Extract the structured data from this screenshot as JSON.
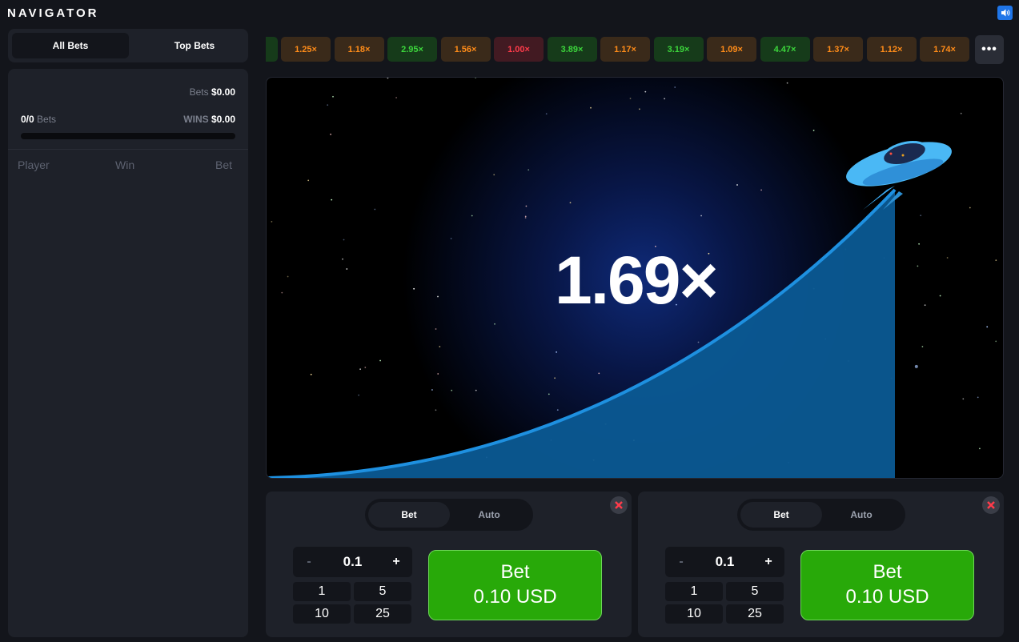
{
  "app": {
    "logo": "NAVIGATOR",
    "sound_icon": "speaker-icon"
  },
  "sidebar": {
    "tabs": [
      {
        "label": "All Bets",
        "active": true
      },
      {
        "label": "Top Bets",
        "active": false
      }
    ],
    "bets_label": "Bets",
    "bets_total": "$0.00",
    "bets_count": "0/0",
    "bets_count_label": "Bets",
    "wins_label": "WINS",
    "wins_total": "$0.00",
    "columns": [
      "Player",
      "Win",
      "Bet"
    ]
  },
  "history": [
    {
      "value": "",
      "color": "green"
    },
    {
      "value": "1.25×",
      "color": "orange"
    },
    {
      "value": "1.18×",
      "color": "orange"
    },
    {
      "value": "2.95×",
      "color": "green"
    },
    {
      "value": "1.56×",
      "color": "orange"
    },
    {
      "value": "1.00×",
      "color": "red"
    },
    {
      "value": "3.89×",
      "color": "green"
    },
    {
      "value": "1.17×",
      "color": "orange"
    },
    {
      "value": "3.19×",
      "color": "green"
    },
    {
      "value": "1.09×",
      "color": "orange"
    },
    {
      "value": "4.47×",
      "color": "green"
    },
    {
      "value": "1.37×",
      "color": "orange"
    },
    {
      "value": "1.12×",
      "color": "orange"
    },
    {
      "value": "1.74×",
      "color": "orange"
    }
  ],
  "history_more": "•••",
  "game": {
    "multiplier": "1.69×",
    "ship_icon": "ufo-icon"
  },
  "bet_panels": [
    {
      "modes": [
        "Bet",
        "Auto"
      ],
      "active_mode": "Bet",
      "minus": "-",
      "plus": "+",
      "amount": "0.1",
      "quick": [
        "1",
        "5",
        "10",
        "25"
      ],
      "button_line1": "Bet",
      "button_line2": "0.10 USD"
    },
    {
      "modes": [
        "Bet",
        "Auto"
      ],
      "active_mode": "Bet",
      "minus": "-",
      "plus": "+",
      "amount": "0.1",
      "quick": [
        "1",
        "5",
        "10",
        "25"
      ],
      "button_line1": "Bet",
      "button_line2": "0.10 USD"
    }
  ],
  "colors": {
    "accent_green": "#28a909",
    "curve_blue": "#1e90e0",
    "ship_blue": "#4ab8f5"
  }
}
